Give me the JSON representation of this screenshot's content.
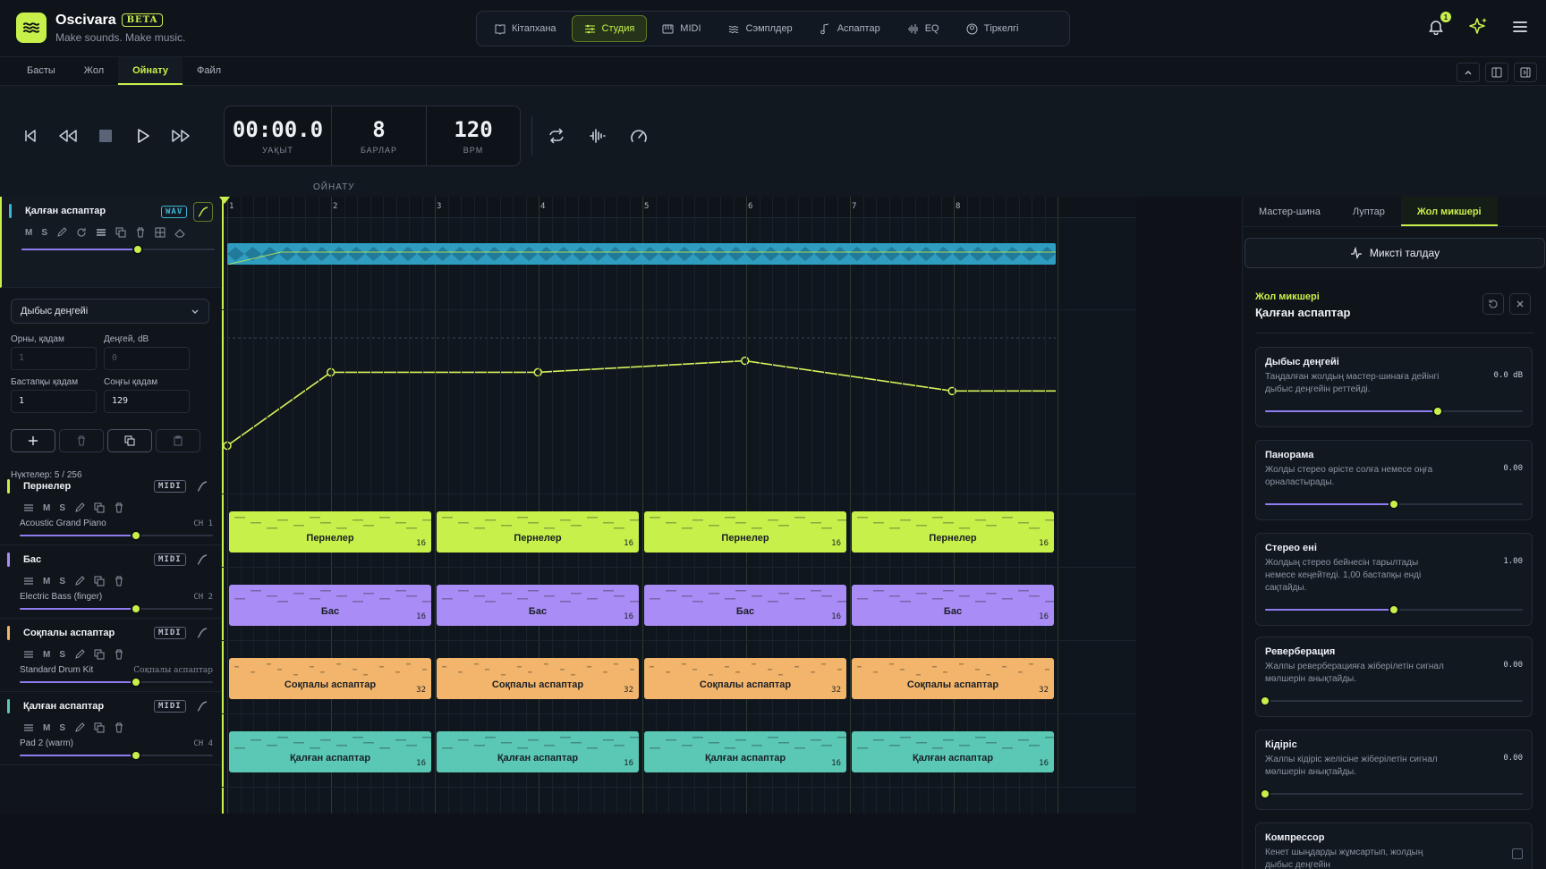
{
  "app": {
    "name": "Oscivara",
    "beta": "BETA",
    "tagline": "Make sounds. Make music."
  },
  "nav": [
    {
      "label": "Кітапхана",
      "icon": "book-icon"
    },
    {
      "label": "Студия",
      "icon": "sliders-icon",
      "active": true
    },
    {
      "label": "MIDI",
      "icon": "piano-icon"
    },
    {
      "label": "Сэмплдер",
      "icon": "waves-icon"
    },
    {
      "label": "Аспаптар",
      "icon": "note-icon"
    },
    {
      "label": "EQ",
      "icon": "waveform-icon"
    },
    {
      "label": "Тіркелгі",
      "icon": "user-icon"
    }
  ],
  "notifications": {
    "count": "1"
  },
  "subtabs": [
    "Басты",
    "Жол",
    "Ойнату",
    "Файл"
  ],
  "subtab_active": 2,
  "transport": {
    "time": "00:00.0",
    "time_label": "УАҚЫТ",
    "bars": "8",
    "bars_label": "БАРЛАР",
    "bpm": "120",
    "bpm_label": "BPM"
  },
  "section_label": "ОЙНАТУ",
  "ruler": [
    "1",
    "2",
    "3",
    "4",
    "5",
    "6",
    "7",
    "8"
  ],
  "tracks": [
    {
      "name": "Қалған аспаптар",
      "tag": "WAV",
      "color": "#3db4d6",
      "icons": [
        "M",
        "S"
      ],
      "volume": 0.6
    },
    {
      "name": "Пернелер",
      "tag": "MIDI",
      "color": "#c8f04a",
      "instrument": "Acoustic Grand Piano",
      "ch": "CH 1",
      "volume": 0.6
    },
    {
      "name": "Бас",
      "tag": "MIDI",
      "color": "#a98cf5",
      "instrument": "Electric Bass (finger)",
      "ch": "CH 2",
      "volume": 0.6
    },
    {
      "name": "Соқпалы аспаптар",
      "tag": "MIDI",
      "color": "#f2b56b",
      "instrument": "Standard Drum Kit",
      "ch": "Соқпалы аспаптар",
      "volume": 0.6
    },
    {
      "name": "Қалған аспаптар",
      "tag": "MIDI",
      "color": "#5ac8b4",
      "instrument": "Pad 2 (warm)",
      "ch": "CH 4",
      "volume": 0.6
    }
  ],
  "automation": {
    "param": "Дыбыс деңгейі",
    "pos_label": "Орны, қадам",
    "pos_value": "1",
    "level_label": "Деңгей, dB",
    "level_value": "0",
    "start_label": "Бастапқы қадам",
    "start_value": "1",
    "end_label": "Соңғы қадам",
    "end_value": "129",
    "nodes": "Нүктелер: 5 / 256",
    "points": [
      [
        0,
        0.27
      ],
      [
        0.125,
        0.78
      ],
      [
        0.375,
        0.78
      ],
      [
        0.625,
        0.86
      ],
      [
        0.875,
        0.65
      ],
      [
        1.0,
        0.65
      ]
    ]
  },
  "clips": [
    {
      "track": 1,
      "label": "Пернелер",
      "count": "16",
      "color": "#c8f04a"
    },
    {
      "track": 2,
      "label": "Бас",
      "count": "16",
      "color": "#a98cf5"
    },
    {
      "track": 3,
      "label": "Соқпалы аспаптар",
      "count": "32",
      "color": "#f2b56b"
    },
    {
      "track": 4,
      "label": "Қалған аспаптар",
      "count": "16",
      "color": "#5ac8b4"
    }
  ],
  "right": {
    "tabs": [
      "Мастер-шина",
      "Луптар",
      "Жол микшері"
    ],
    "active_tab": 2,
    "analyze": "Миксті талдау",
    "kicker": "Жол микшері",
    "title": "Қалған аспаптар",
    "cards": [
      {
        "title": "Дыбыс деңгейі",
        "desc": "Таңдалған жолдың мастер-шинаға дейінгі дыбыс деңгейін реттейді.",
        "value": "0.0 dB",
        "level": 0.67
      },
      {
        "title": "Панорама",
        "desc": "Жолды стерео өрісте солға немесе оңға орналастырады.",
        "value": "0.00",
        "level": 0.5
      },
      {
        "title": "Стерео ені",
        "desc": "Жолдың стерео бейнесін тарылтады немесе кеңейтеді. 1,00 бастапқы енді сақтайды.",
        "value": "1.00",
        "level": 0.5
      },
      {
        "title": "Реверберация",
        "desc": "Жалпы реверберацияға жіберілетін сигнал мөлшерін анықтайды.",
        "value": "0.00",
        "level": 0.0
      },
      {
        "title": "Кідіріс",
        "desc": "Жалпы кідіріс желісіне жіберілетін сигнал мөлшерін анықтайды.",
        "value": "0.00",
        "level": 0.0
      },
      {
        "title": "Компрессор",
        "desc": "Кенет шыңдарды жұмсартып, жолдың дыбыс деңгейін",
        "value": "",
        "level": null
      }
    ]
  }
}
